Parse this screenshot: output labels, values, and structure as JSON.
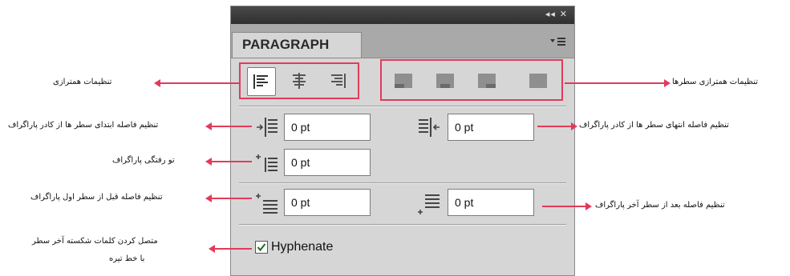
{
  "panel": {
    "title_controls": "◂◂ ✕",
    "tab_label": "PARAGRAPH",
    "menu_icon": "panel-menu-icon"
  },
  "alignment_buttons": [
    {
      "name": "align-left-button",
      "icon": "align-left-icon",
      "selected": true
    },
    {
      "name": "align-center-button",
      "icon": "align-center-icon",
      "selected": false
    },
    {
      "name": "align-right-button",
      "icon": "align-right-icon",
      "selected": false
    }
  ],
  "justify_buttons": [
    {
      "name": "justify-left-button",
      "icon": "justify-last-left-icon"
    },
    {
      "name": "justify-center-button",
      "icon": "justify-last-center-icon"
    },
    {
      "name": "justify-right-button",
      "icon": "justify-last-right-icon"
    },
    {
      "name": "justify-all-button",
      "icon": "justify-all-icon"
    }
  ],
  "fields": {
    "left_indent": "0 pt",
    "right_indent": "0 pt",
    "first_line_indent": "0 pt",
    "space_before": "0 pt",
    "space_after": "0 pt"
  },
  "hyphenate": {
    "label": "Hyphenate",
    "checked": true
  },
  "annotations": {
    "alignment": "تنظیمات همترازی",
    "justify": "تنظیمات همترازی سطرها",
    "left_indent": "تنظیم فاصله ابتدای سطر ها از کادر پاراگراف",
    "right_indent": "تنظیم فاصله انتهای سطر ها از کادر پاراگراف",
    "first_line": "تو رفتگی پاراگراف",
    "space_before": "تنظیم فاصله قبل از سطر اول پاراگراف",
    "space_after": "تنظیم فاصله بعد از سطر آخر پاراگراف",
    "hyphenate_line1": "متصل کردن کلمات شکسته آخر سطر",
    "hyphenate_line2": "با خط تیره"
  },
  "colors": {
    "accent": "#e23b5a",
    "panel_bg": "#d6d6d6",
    "titlebar": "#383838"
  }
}
